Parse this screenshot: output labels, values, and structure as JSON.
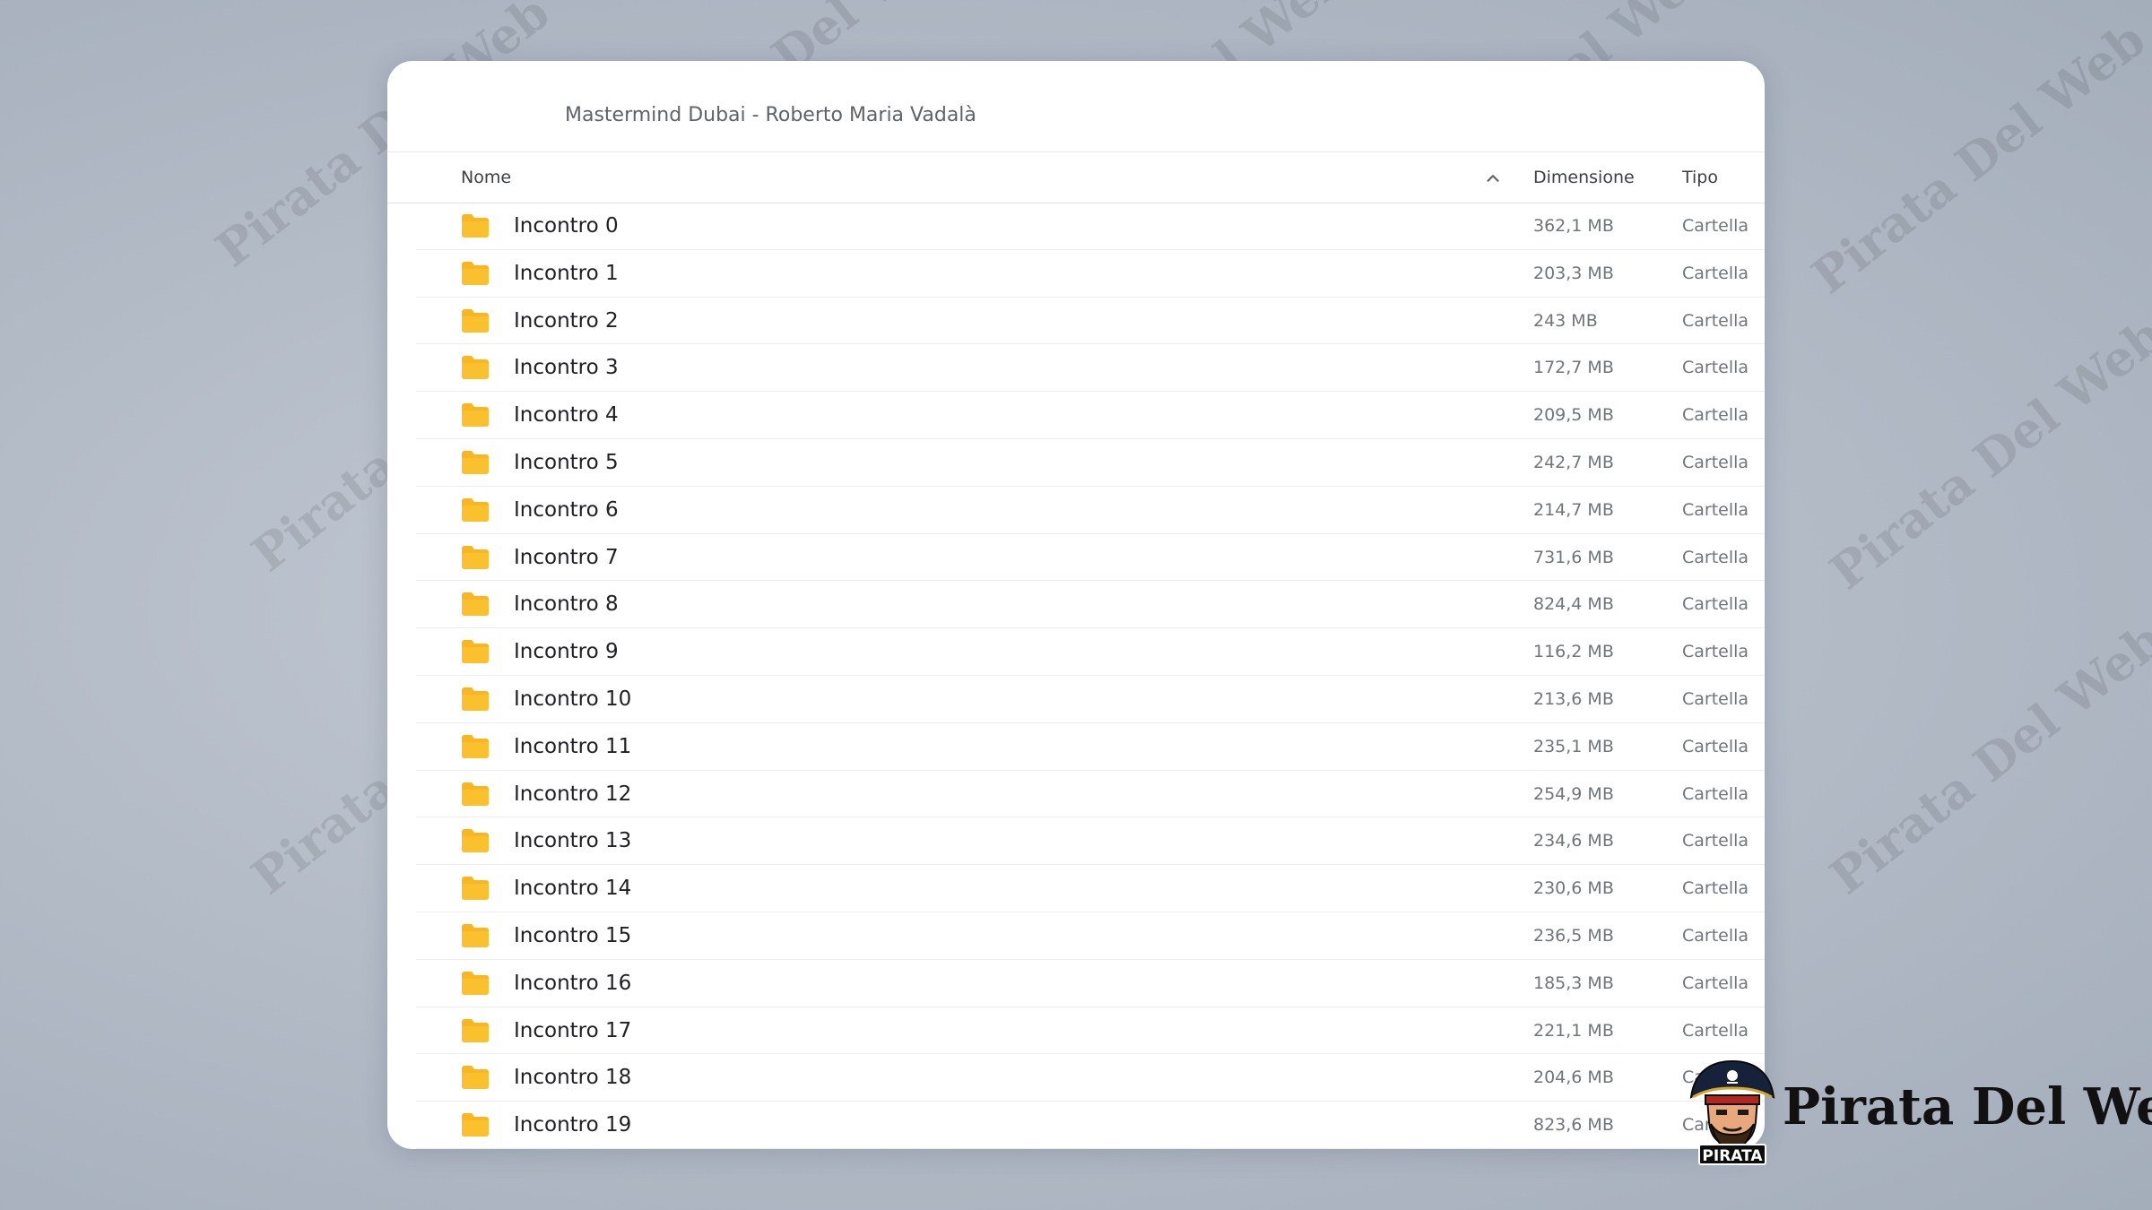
{
  "breadcrumb": "Mastermind Dubai - Roberto Maria Vadalà",
  "columns": {
    "name": "Nome",
    "size": "Dimensione",
    "type": "Tipo"
  },
  "sort": {
    "column": "name",
    "direction": "ascending"
  },
  "files": [
    {
      "name": "Incontro 0",
      "size": "362,1 MB",
      "type": "Cartella"
    },
    {
      "name": "Incontro 1",
      "size": "203,3 MB",
      "type": "Cartella"
    },
    {
      "name": "Incontro 2",
      "size": "243 MB",
      "type": "Cartella"
    },
    {
      "name": "Incontro 3",
      "size": "172,7 MB",
      "type": "Cartella"
    },
    {
      "name": "Incontro 4",
      "size": "209,5 MB",
      "type": "Cartella"
    },
    {
      "name": "Incontro 5",
      "size": "242,7 MB",
      "type": "Cartella"
    },
    {
      "name": "Incontro 6",
      "size": "214,7 MB",
      "type": "Cartella"
    },
    {
      "name": "Incontro 7",
      "size": "731,6 MB",
      "type": "Cartella"
    },
    {
      "name": "Incontro 8",
      "size": "824,4 MB",
      "type": "Cartella"
    },
    {
      "name": "Incontro 9",
      "size": "116,2 MB",
      "type": "Cartella"
    },
    {
      "name": "Incontro 10",
      "size": "213,6 MB",
      "type": "Cartella"
    },
    {
      "name": "Incontro 11",
      "size": "235,1 MB",
      "type": "Cartella"
    },
    {
      "name": "Incontro 12",
      "size": "254,9 MB",
      "type": "Cartella"
    },
    {
      "name": "Incontro 13",
      "size": "234,6 MB",
      "type": "Cartella"
    },
    {
      "name": "Incontro 14",
      "size": "230,6 MB",
      "type": "Cartella"
    },
    {
      "name": "Incontro 15",
      "size": "236,5 MB",
      "type": "Cartella"
    },
    {
      "name": "Incontro 16",
      "size": "185,3 MB",
      "type": "Cartella"
    },
    {
      "name": "Incontro 17",
      "size": "221,1 MB",
      "type": "Cartella"
    },
    {
      "name": "Incontro 18",
      "size": "204,6 MB",
      "type": "Cartella"
    },
    {
      "name": "Incontro 19",
      "size": "823,6 MB",
      "type": "Cartella"
    }
  ],
  "icons": {
    "folder": "folder-icon",
    "sort": "chevron-up-icon"
  },
  "colors": {
    "folder": "#f9b620",
    "background": "#b7bfca",
    "panel": "#ffffff"
  },
  "watermark_text": "Pirata Del Web",
  "brand": {
    "name": "Pirata Del Web",
    "badge": "PIRATA"
  }
}
